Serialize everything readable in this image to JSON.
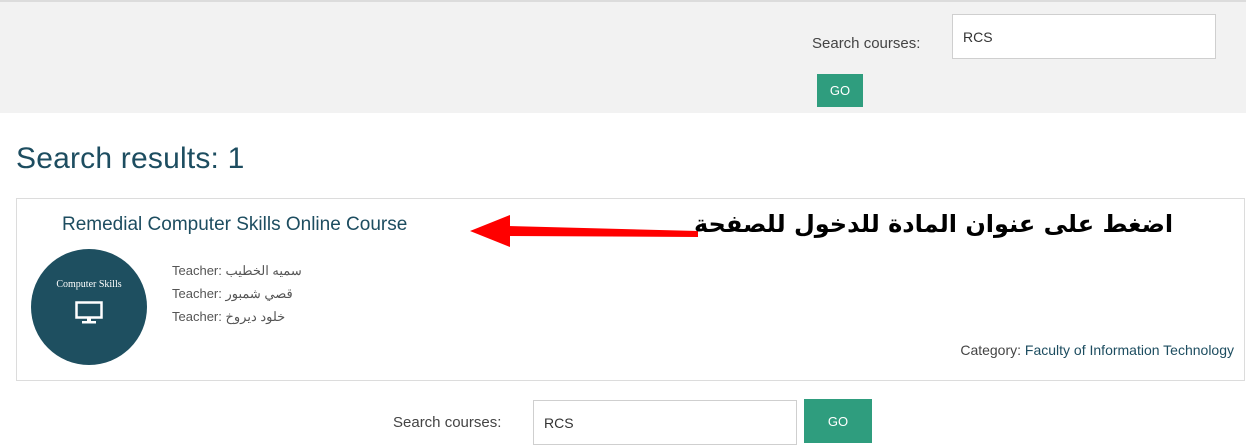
{
  "top_search": {
    "label": "Search courses:",
    "value": "RCS",
    "button": "GO"
  },
  "results": {
    "title": "Search results: 1"
  },
  "course": {
    "title": "Remedial Computer Skills Online Course",
    "image_text": "Computer Skills",
    "image_icon": "monitor-icon",
    "teachers": [
      "Teacher: سميه الخطيب",
      "Teacher: قصي شمبور",
      "Teacher: خلود ديروخ"
    ],
    "category_label": "Category:",
    "category_value": "Faculty of Information Technology"
  },
  "annotation": {
    "text": "اضغط على عنوان المادة للدخول للصفحة"
  },
  "bottom_search": {
    "label": "Search courses:",
    "value": "RCS",
    "button": "GO"
  },
  "colors": {
    "accent_button": "#2f9d7e",
    "heading": "#1d4d60",
    "course_image_bg": "#1e4f60",
    "arrow": "#ff0000"
  }
}
